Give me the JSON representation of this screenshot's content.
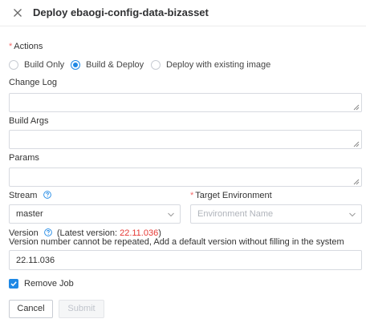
{
  "dialog": {
    "title": "Deploy ebaogi-config-data-bizasset",
    "close_icon": "close-icon"
  },
  "actions": {
    "label": "Actions",
    "required_mark": "*",
    "options": [
      {
        "label": "Build Only",
        "checked": false
      },
      {
        "label": "Build & Deploy",
        "checked": true
      },
      {
        "label": "Deploy with existing image",
        "checked": false
      }
    ]
  },
  "change_log": {
    "label": "Change Log",
    "value": ""
  },
  "build_args": {
    "label": "Build Args",
    "value": ""
  },
  "params": {
    "label": "Params",
    "value": ""
  },
  "stream": {
    "label": "Stream",
    "help_icon": "question-circle-icon",
    "value": "master"
  },
  "target_env": {
    "label": "Target Environment",
    "required_mark": "*",
    "placeholder": "Environment Name"
  },
  "version": {
    "label": "Version",
    "help_icon": "question-circle-icon",
    "latest_prefix": "(Latest version: ",
    "latest_value": "22.11.036",
    "latest_suffix": ")",
    "hint": "Version number cannot be repeated, Add a default version without filling in the system",
    "value": "22.11.036"
  },
  "remove_job": {
    "label": "Remove Job",
    "checked": true
  },
  "buttons": {
    "cancel": "Cancel",
    "submit": "Submit"
  },
  "colors": {
    "accent": "#1e88e5",
    "required": "#f56c6c",
    "latest_version": "#e53935",
    "border": "#d7dae0"
  }
}
